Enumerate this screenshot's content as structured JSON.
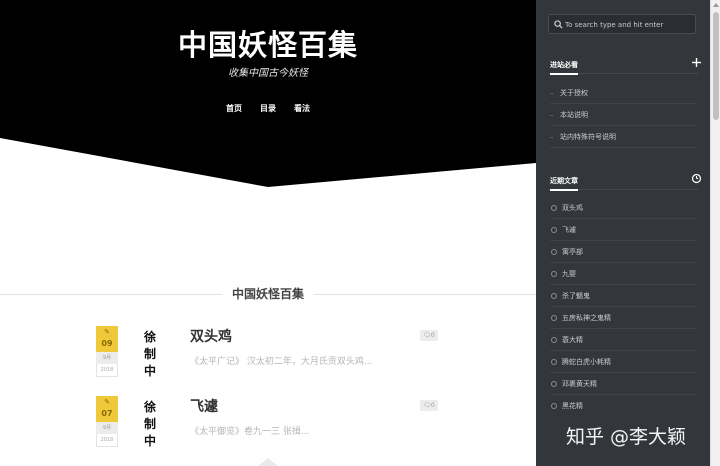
{
  "site": {
    "title": "中国妖怪百集",
    "subtitle": "收集中国古今妖怪",
    "nav": [
      "首页",
      "目录",
      "看法"
    ]
  },
  "section_title": "中国妖怪百集",
  "posts": [
    {
      "day": "09",
      "month": "9月",
      "year": "2018",
      "thumb_chars": [
        "徐",
        "制",
        "中"
      ],
      "title": "双头鸡",
      "excerpt": "《太平广记》 汉太初二年，大月氏贡双头鸡...",
      "comments": "0"
    },
    {
      "day": "07",
      "month": "9月",
      "year": "2018",
      "thumb_chars": [
        "徐",
        "制",
        "中"
      ],
      "title": "飞遽",
      "excerpt": "《太平御览》卷九一三 张揖...",
      "comments": "0"
    }
  ],
  "sidebar": {
    "search_placeholder": "To search type and hit enter",
    "widget1": {
      "title": "进站必看",
      "items": [
        "关于授权",
        "本站说明",
        "站内特殊符号说明"
      ]
    },
    "widget2": {
      "title": "近期文章",
      "items": [
        "双头鸡",
        "飞遽",
        "寓亭部",
        "九婴",
        "杀了魑鬼",
        "五房私神之鬼精",
        "蓑大精",
        "腾蛇白虎小耗精",
        "邓裹黄天精",
        "黑花精"
      ]
    }
  },
  "watermark": "知乎 @李大颖",
  "colors": {
    "hero_bg": "#000000",
    "sidebar_bg": "#33363b",
    "date_badge": "#f0c93b"
  }
}
